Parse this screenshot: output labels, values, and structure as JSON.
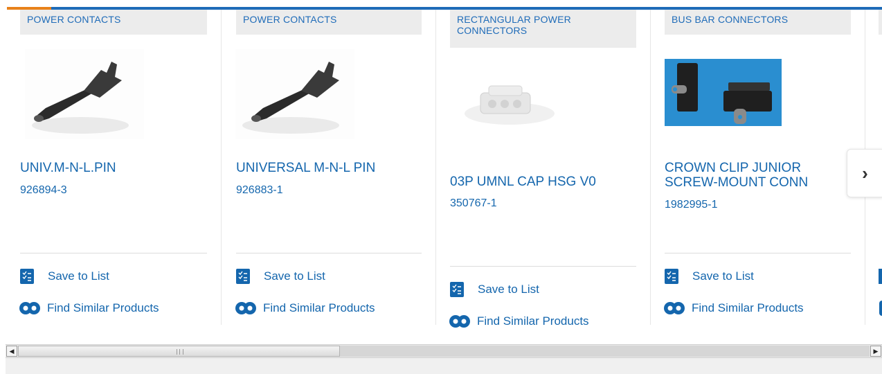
{
  "colors": {
    "accent": "#1e6bb8",
    "highlight": "#e8811a",
    "link": "#1466ad",
    "category_bg": "#ececec"
  },
  "products": [
    {
      "category": "POWER CONTACTS",
      "name": "UNIV.M-N-L.PIN",
      "part": "926894-3",
      "save_label": "Save to List",
      "similar_label": "Find Similar Products",
      "image": "pin-contact-photo"
    },
    {
      "category": "POWER CONTACTS",
      "name": "UNIVERSAL M-N-L PIN",
      "part": "926883-1",
      "save_label": "Save to List",
      "similar_label": "Find Similar Products",
      "image": "pin-contact-photo"
    },
    {
      "category": "RECTANGULAR POWER CONNECTORS",
      "name": "03P UMNL CAP HSG V0",
      "part": "350767-1",
      "save_label": "Save to List",
      "similar_label": "Find Similar Products",
      "image": "cap-housing-photo"
    },
    {
      "category": "BUS BAR CONNECTORS",
      "name": "CROWN CLIP JUNIOR SCREW-MOUNT CONN",
      "part": "1982995-1",
      "save_label": "Save to List",
      "similar_label": "Find Similar Products",
      "image": "bus-bar-clip-photo"
    }
  ],
  "carousel": {
    "next_icon": "chevron-right-icon",
    "next_glyph": "›"
  },
  "scrollbar": {
    "left_arrow": "◀",
    "right_arrow": "▶",
    "position": 0.0,
    "visible_fraction": 0.37
  }
}
